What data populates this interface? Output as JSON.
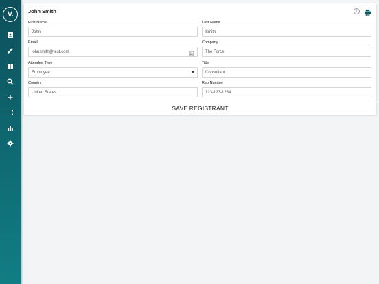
{
  "sidebar": {
    "logo": "V.",
    "items": [
      {
        "icon": "contact-card-icon"
      },
      {
        "icon": "pencil-icon"
      },
      {
        "icon": "book-icon"
      },
      {
        "icon": "search-icon"
      },
      {
        "icon": "plus-icon"
      },
      {
        "icon": "scan-frame-icon"
      },
      {
        "icon": "bar-chart-icon"
      },
      {
        "icon": "gear-icon"
      }
    ]
  },
  "card": {
    "title": "John Smith",
    "info_icon": "info-icon",
    "print_icon": "printer-icon",
    "fields": {
      "first_name": {
        "label": "First Name",
        "value": "John"
      },
      "last_name": {
        "label": "Last Name",
        "value": "Smith"
      },
      "email": {
        "label": "Email",
        "value": "johnsmith@test.com"
      },
      "company": {
        "label": "Company",
        "value": "The Force"
      },
      "attendee_type": {
        "label": "Attendee Type",
        "value": "Employee"
      },
      "title": {
        "label": "Title",
        "value": "Consultant"
      },
      "country": {
        "label": "Country",
        "value": "United States"
      },
      "rep_number": {
        "label": "Rep Number",
        "value": "123-123-1234"
      }
    },
    "save_label": "SAVE REGISTRANT"
  },
  "colors": {
    "sidebar_top": "#0d4f5a",
    "sidebar_bottom": "#127d84",
    "accent": "#0d5c66",
    "background": "#f3f4f5"
  }
}
